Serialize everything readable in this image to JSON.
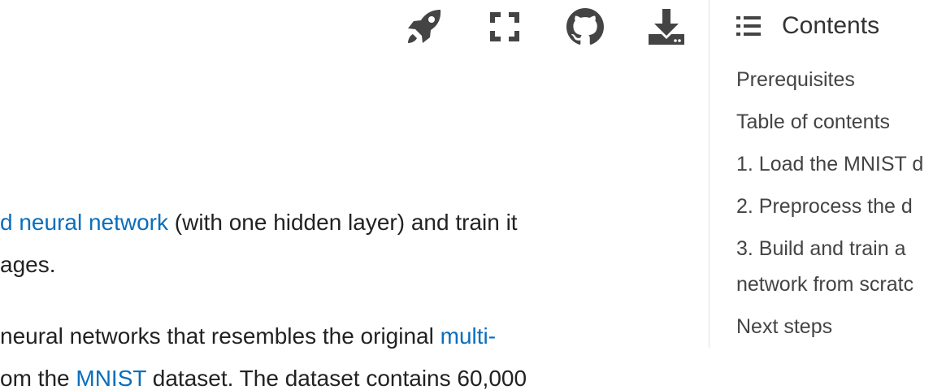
{
  "toolbar": {
    "icons": [
      {
        "name": "launch-rocket-icon"
      },
      {
        "name": "fullscreen-icon"
      },
      {
        "name": "github-icon"
      },
      {
        "name": "download-icon"
      }
    ],
    "icon_color": "#444444"
  },
  "article": {
    "paragraph1": {
      "line1_link": "d neural network",
      "line1_rest": " (with one hidden layer) and train it",
      "line2": "ages."
    },
    "paragraph2": {
      "line1_text": "neural networks that resembles the original ",
      "line1_link": "multi-",
      "line2_before": "om the ",
      "line2_link": "MNIST",
      "line2_after": " dataset. The dataset contains 60,000"
    },
    "link_color": "#0a6ebd"
  },
  "toc": {
    "title": "Contents",
    "items": [
      "Prerequisites",
      "Table of contents",
      "1. Load the MNIST d",
      "2. Preprocess the d",
      "3. Build and train a",
      "network from scratc",
      "Next steps"
    ]
  }
}
